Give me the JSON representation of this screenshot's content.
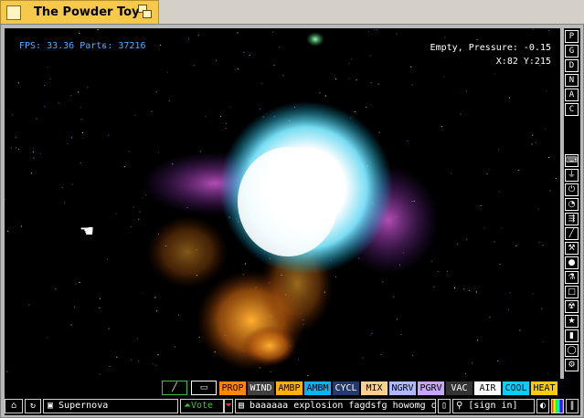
{
  "window": {
    "title": "The Powder Toy"
  },
  "hud": {
    "fps_parts": "FPS: 33.36 Parts: 37216",
    "status": "Empty, Pressure: -0.15",
    "coords": "X:82 Y:215"
  },
  "side_letters": [
    "P",
    "G",
    "D",
    "N",
    "A",
    "C"
  ],
  "side_icons": [
    "keyboard-icon",
    "plug-icon",
    "power-icon",
    "pressure-icon",
    "sensor-icon",
    "pen-icon",
    "tool-icon",
    "drop-icon",
    "beaker-icon",
    "square-icon",
    "radiation-icon",
    "star-icon",
    "bookmark-icon",
    "bulb-icon",
    "wrench-icon"
  ],
  "tools": [
    {
      "label": "PROP",
      "bg": "#ff8800",
      "fg": "#000"
    },
    {
      "label": "WIND",
      "bg": "#404040",
      "fg": "#fff"
    },
    {
      "label": "AMBP",
      "bg": "#ffb000",
      "fg": "#000"
    },
    {
      "label": "AMBM",
      "bg": "#00b4ff",
      "fg": "#000"
    },
    {
      "label": "CYCL",
      "bg": "#233a6b",
      "fg": "#fff"
    },
    {
      "label": "MIX",
      "bg": "#ffd090",
      "fg": "#000"
    },
    {
      "label": "NGRV",
      "bg": "#b0b8ff",
      "fg": "#000"
    },
    {
      "label": "PGRV",
      "bg": "#c6a6ff",
      "fg": "#000"
    },
    {
      "label": "VAC",
      "bg": "#333333",
      "fg": "#fff"
    },
    {
      "label": "AIR",
      "bg": "#ffffff",
      "fg": "#000"
    },
    {
      "label": "COOL",
      "bg": "#00d0ff",
      "fg": "#000"
    },
    {
      "label": "HEAT",
      "bg": "#ffcc00",
      "fg": "#000"
    }
  ],
  "bottom": {
    "save_name": "Supernova",
    "vote_label": "Vote",
    "description": "baaaaaa explosion fagdsfg howomg ohgod...",
    "sign_in": "[sign in]"
  }
}
